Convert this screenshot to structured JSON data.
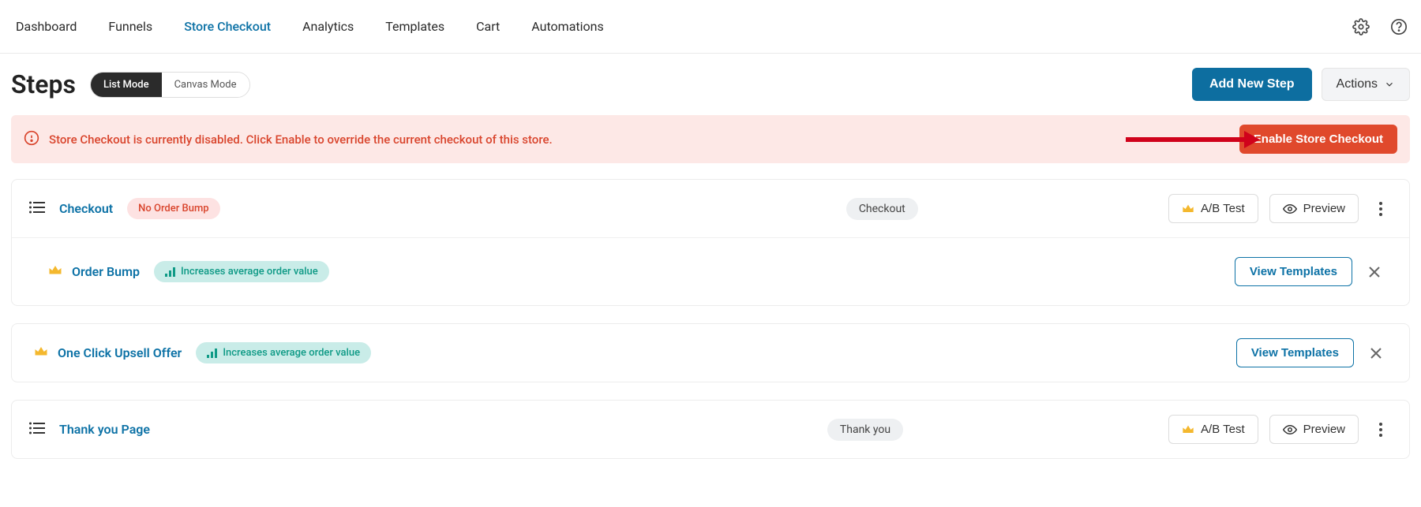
{
  "nav": {
    "items": [
      {
        "label": "Dashboard"
      },
      {
        "label": "Funnels"
      },
      {
        "label": "Store Checkout",
        "active": true
      },
      {
        "label": "Analytics"
      },
      {
        "label": "Templates"
      },
      {
        "label": "Cart"
      },
      {
        "label": "Automations"
      }
    ]
  },
  "header": {
    "title": "Steps",
    "mode_list": "List Mode",
    "mode_canvas": "Canvas Mode",
    "add_new": "Add New Step",
    "actions_label": "Actions"
  },
  "alert": {
    "text": "Store Checkout is currently disabled. Click Enable to override the current checkout of this store.",
    "button": "Enable Store Checkout"
  },
  "steps": {
    "checkout": {
      "name": "Checkout",
      "badge": "No Order Bump",
      "type": "Checkout",
      "ab_test": "A/B Test",
      "preview": "Preview",
      "sub": {
        "name": "Order Bump",
        "pill": "Increases average order value",
        "view_templates": "View Templates"
      }
    },
    "upsell": {
      "name": "One Click Upsell Offer",
      "pill": "Increases average order value",
      "view_templates": "View Templates"
    },
    "thankyou": {
      "name": "Thank you Page",
      "type": "Thank you",
      "ab_test": "A/B Test",
      "preview": "Preview"
    }
  }
}
